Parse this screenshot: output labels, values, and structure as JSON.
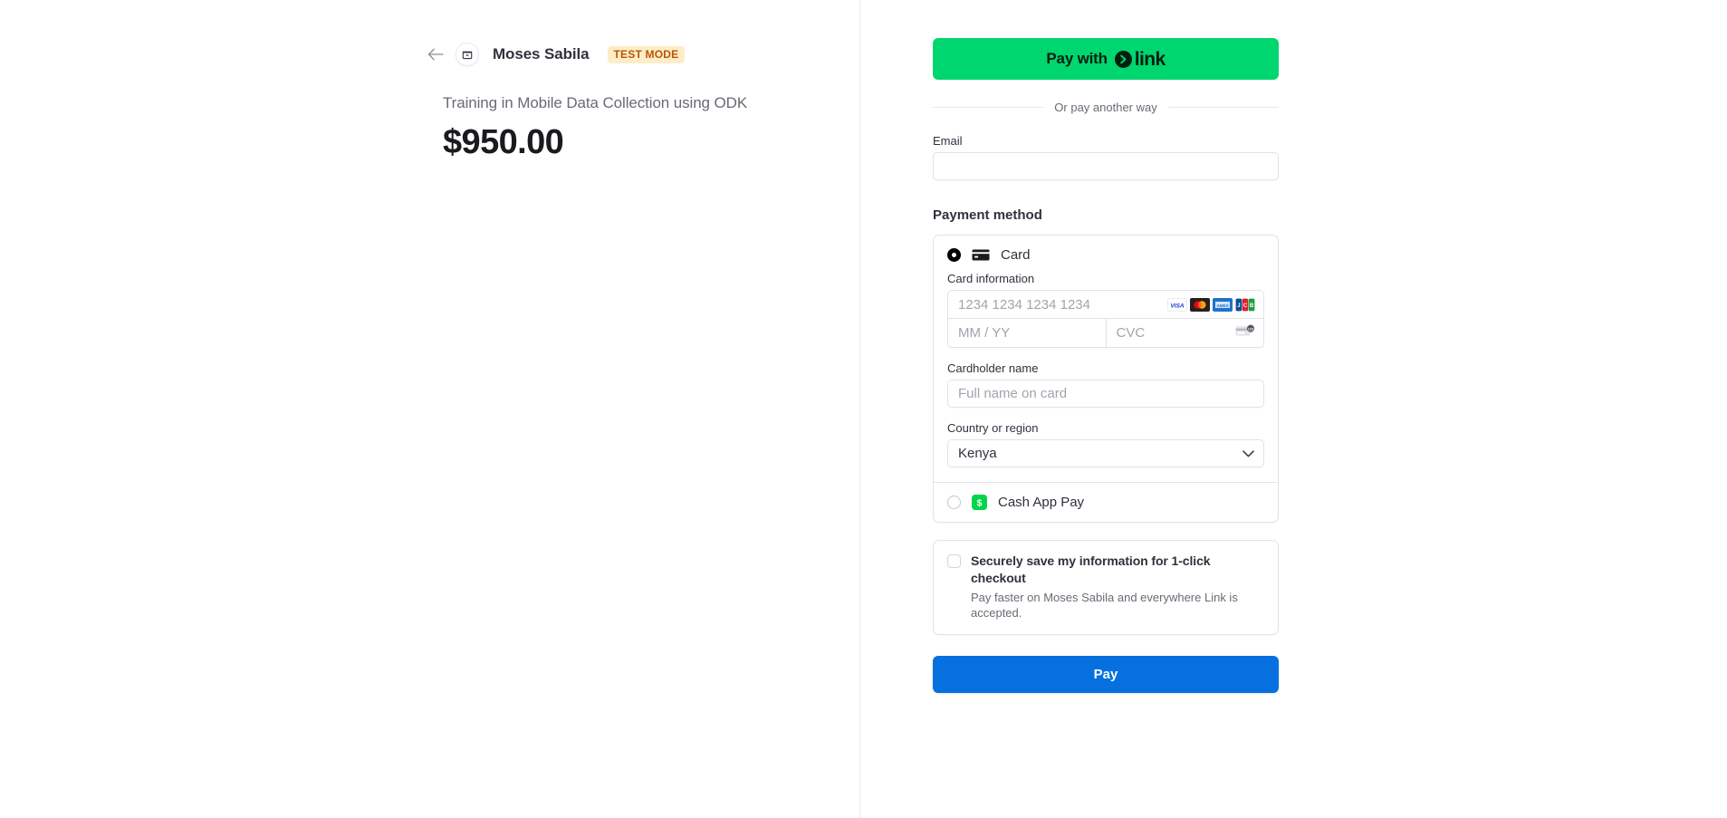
{
  "merchant": {
    "back_icon": "arrow-left-icon",
    "avatar_icon": "storefront-icon",
    "name": "Moses Sabila",
    "test_badge": "TEST MODE"
  },
  "product": {
    "name": "Training in Mobile Data Collection using ODK",
    "amount": "$950.00"
  },
  "express_checkout": {
    "prefix_label": "Pay with",
    "wordmark": "link",
    "logo_icon": "link-chevron-icon",
    "background_color": "#00d66f"
  },
  "divider": {
    "text": "Or pay another way"
  },
  "email": {
    "label": "Email",
    "value": "",
    "placeholder": ""
  },
  "payment_method": {
    "section_title": "Payment method",
    "options": [
      {
        "id": "card",
        "label": "Card",
        "icon": "credit-card-icon",
        "selected": true
      },
      {
        "id": "cashapp",
        "label": "Cash App Pay",
        "icon": "cash-app-icon",
        "selected": false,
        "icon_color": "#00d54b"
      }
    ],
    "card_form": {
      "card_information_label": "Card information",
      "card_number_placeholder": "1234 1234 1234 1234",
      "card_number_value": "",
      "expiry_placeholder": "MM / YY",
      "expiry_value": "",
      "cvc_placeholder": "CVC",
      "cvc_value": "",
      "cvc_icon": "cvc-card-icon",
      "accepted_brands": [
        "visa",
        "mastercard",
        "amex",
        "jcb"
      ],
      "cardholder_label": "Cardholder name",
      "cardholder_placeholder": "Full name on card",
      "cardholder_value": "",
      "country_label": "Country or region",
      "country_value": "Kenya",
      "country_chevron_icon": "chevron-down-icon"
    }
  },
  "save_info": {
    "checked": false,
    "title": "Securely save my information for 1-click checkout",
    "subtitle": "Pay faster on Moses Sabila and everywhere Link is accepted."
  },
  "submit": {
    "label": "Pay",
    "background_color": "#0570de"
  }
}
